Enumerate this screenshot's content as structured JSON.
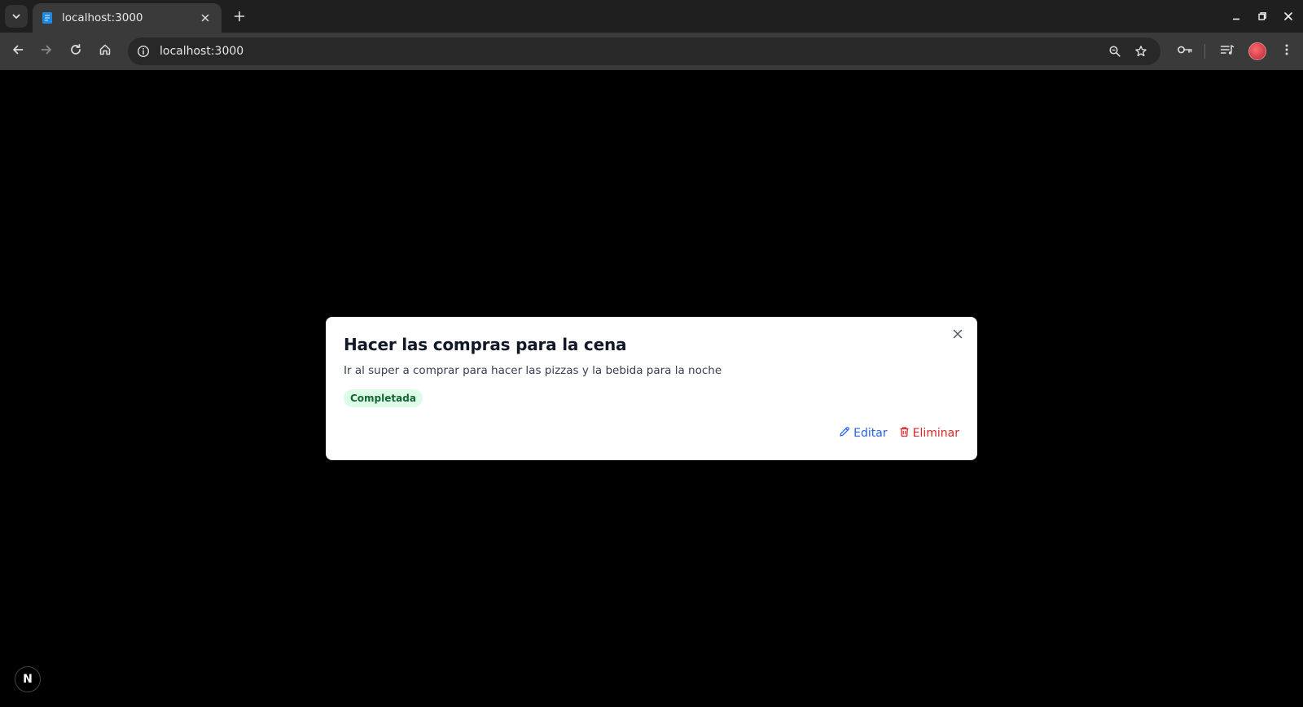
{
  "browser": {
    "tab": {
      "title": "localhost:3000",
      "favicon": "file-icon"
    },
    "address": {
      "url": "localhost:3000"
    },
    "colors": {
      "tabbar": "#1f1f1f",
      "toolbar": "#3a3a3a",
      "omnibox": "#282828"
    }
  },
  "page": {
    "background": "#000000",
    "task": {
      "title": "Hacer las compras para la cena",
      "description": "Ir al super a comprar para hacer las pizzas y la bebida para la noche",
      "status": "Completada",
      "status_color": "#166534",
      "status_bg": "#dcfce7",
      "actions": {
        "edit_label": "Editar",
        "edit_color": "#2563eb",
        "delete_label": "Eliminar",
        "delete_color": "#dc2626"
      }
    },
    "dev_indicator": {
      "label": "N"
    }
  }
}
